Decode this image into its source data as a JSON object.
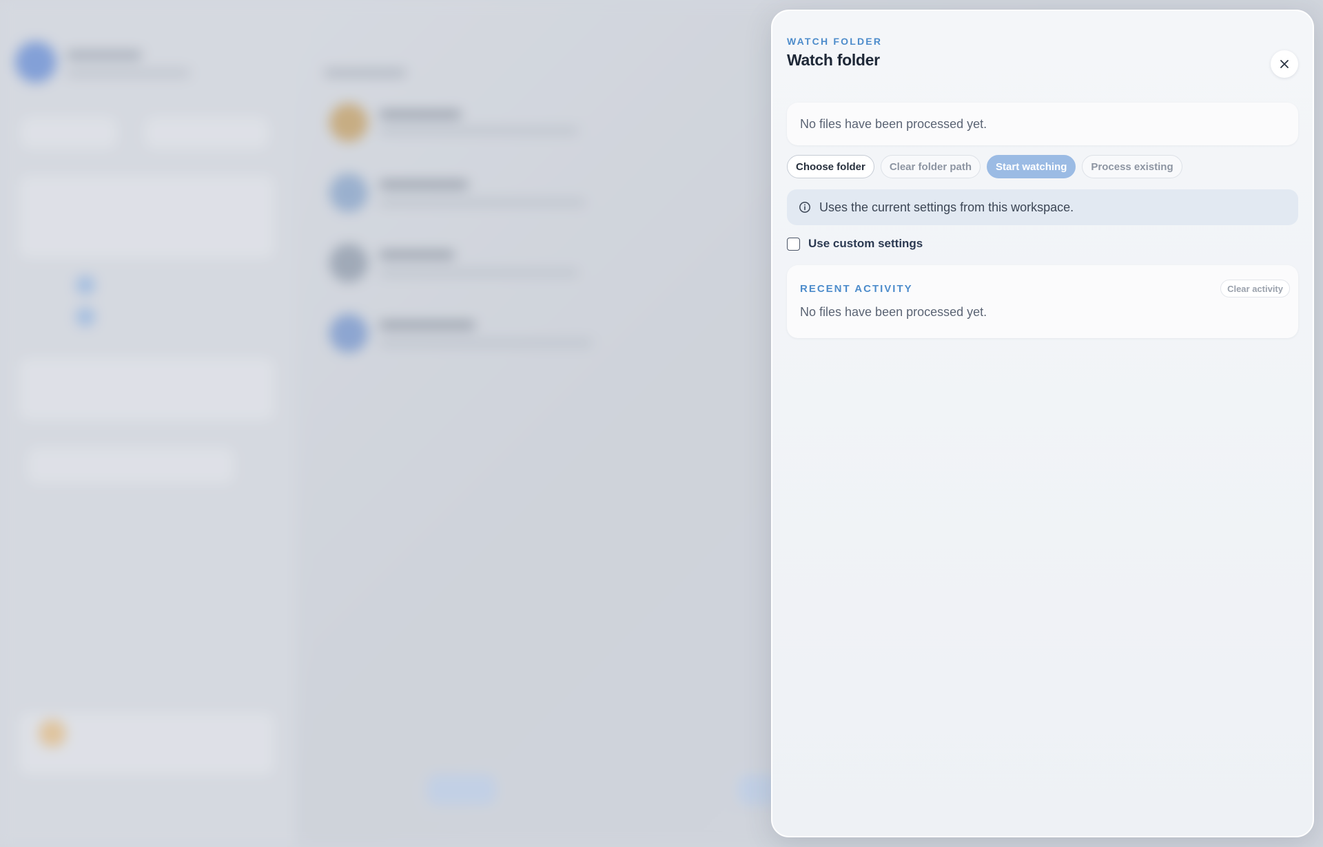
{
  "drawer": {
    "eyebrow": "WATCH FOLDER",
    "title": "Watch folder",
    "close_icon": "close-icon",
    "status_text": "No files have been processed yet.",
    "buttons": {
      "choose_folder": "Choose folder",
      "clear_folder_path": "Clear folder path",
      "start_watching": "Start watching",
      "process_existing": "Process existing"
    },
    "info_banner": {
      "icon": "info-icon",
      "text": "Uses the current settings from this workspace."
    },
    "custom_settings": {
      "label": "Use custom settings",
      "checked": false
    },
    "recent_activity": {
      "label": "RECENT ACTIVITY",
      "clear_label": "Clear activity",
      "empty_text": "No files have been processed yet."
    }
  },
  "colors": {
    "accent": "#4d8ccb",
    "primary_disabled": "#9bbbe4",
    "title": "#1e2837"
  }
}
